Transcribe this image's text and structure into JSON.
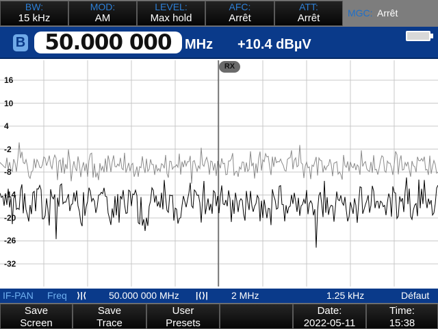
{
  "topbar": {
    "params": [
      {
        "label": "BW:",
        "value": "15 kHz"
      },
      {
        "label": "MOD:",
        "value": "AM"
      },
      {
        "label": "LEVEL:",
        "value": "Max hold"
      },
      {
        "label": "AFC:",
        "value": "Arrêt"
      },
      {
        "label": "ATT:",
        "value": "Arrêt"
      }
    ],
    "mgc": {
      "label": "MGC:",
      "value": "Arrêt"
    }
  },
  "freqbar": {
    "badge": "B",
    "frequency": "50.000 000",
    "unit": "MHz",
    "level": "+10.4 dBµV"
  },
  "spectrum": {
    "marker": "RX",
    "y_ticks": [
      "16",
      "10",
      "4",
      "-2",
      "-8",
      "-14",
      "-20",
      "-26",
      "-32"
    ]
  },
  "statusbar": {
    "mode": "IF-PAN",
    "freq_label": "Freq",
    "center_freq": "50.000 000 MHz",
    "span": "2 MHz",
    "resolution": "1.25 kHz",
    "preset": "Défaut"
  },
  "softkeys": [
    {
      "line1": "Save",
      "line2": "Screen"
    },
    {
      "line1": "Save",
      "line2": "Trace"
    },
    {
      "line1": "User",
      "line2": "Presets"
    },
    {
      "line1": "",
      "line2": ""
    },
    {
      "line1": "Date:",
      "line2": "2022-05-11"
    },
    {
      "line1": "Time:",
      "line2": "15:38"
    }
  ],
  "colors": {
    "accent_blue": "#0a3a8a",
    "label_blue": "#2d7fd6",
    "grid": "#c8c8c8",
    "trace_max": "#808080",
    "trace_live": "#000000"
  }
}
